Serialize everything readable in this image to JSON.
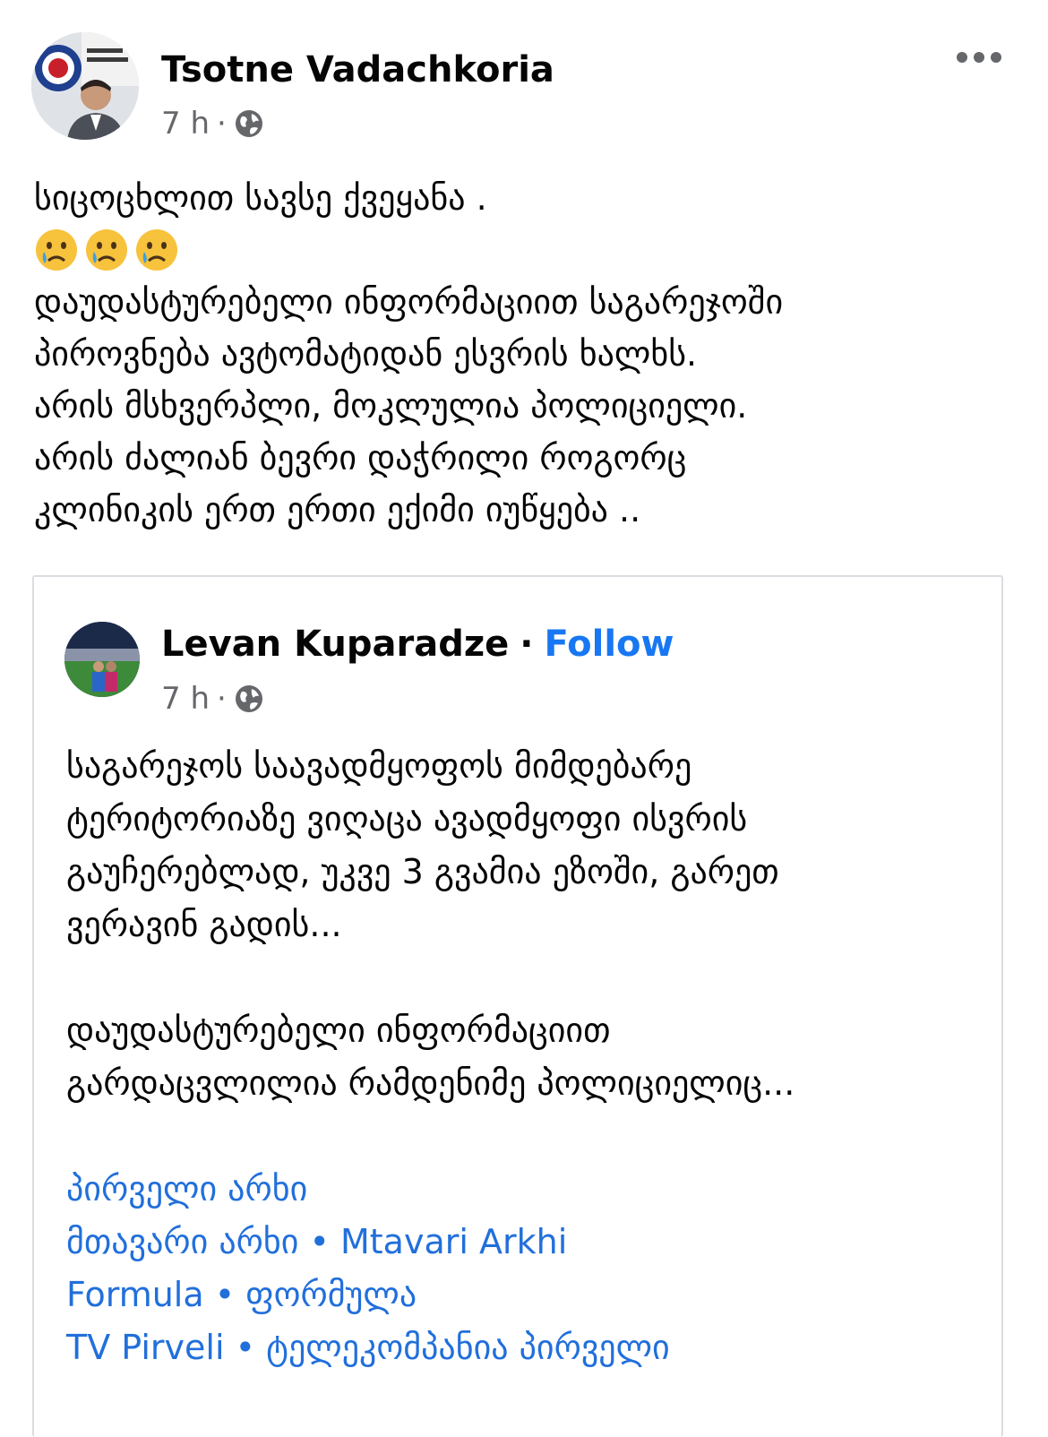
{
  "post": {
    "author": "Tsotne Vadachkoria",
    "time": "7 h",
    "dot": "·",
    "more_icon": "more-horizontal-icon",
    "privacy_icon": "globe-icon",
    "lines": [
      "სიცოცხლით სავსე ქვეყანა .",
      "დაუდასტურებელი ინფორმაციით საგარეჯოში",
      "პიროვნება ავტომატიდან ესვრის ხალხს.",
      "არის მსხვერპლი, მოკლულია პოლიციელი.",
      "არის ძალიან ბევრი დაჭრილი როგორც",
      "კლინიკის ერთ ერთი ექიმი იუწყება .."
    ],
    "emojis": [
      "crying-face",
      "crying-face",
      "crying-face"
    ]
  },
  "shared": {
    "author": "Levan Kuparadze",
    "separator": "·",
    "follow_label": "Follow",
    "time": "7 h",
    "dot": "·",
    "paragraph1": [
      "საგარეჯოს საავადმყოფოს მიმდებარე",
      "ტერიტორიაზე ვიღაცა ავადმყოფი ისვრის",
      "გაუჩერებლად, უკვე 3 გვამია ეზოში, გარეთ",
      "ვერავინ გადის..."
    ],
    "paragraph2": [
      "დაუდასტურებელი ინფორმაციით",
      "გარდაცვლილია რამდენიმე პოლიციელიც..."
    ],
    "tags": [
      "პირველი არხი",
      "მთავარი არხი • Mtavari Arkhi",
      "Formula • ფორმულა",
      "TV Pirveli • ტელეკომპანია პირველი"
    ]
  },
  "colors": {
    "link": "#216fdb",
    "follow": "#1877f2",
    "meta": "#65676b",
    "border": "#dadde1"
  }
}
